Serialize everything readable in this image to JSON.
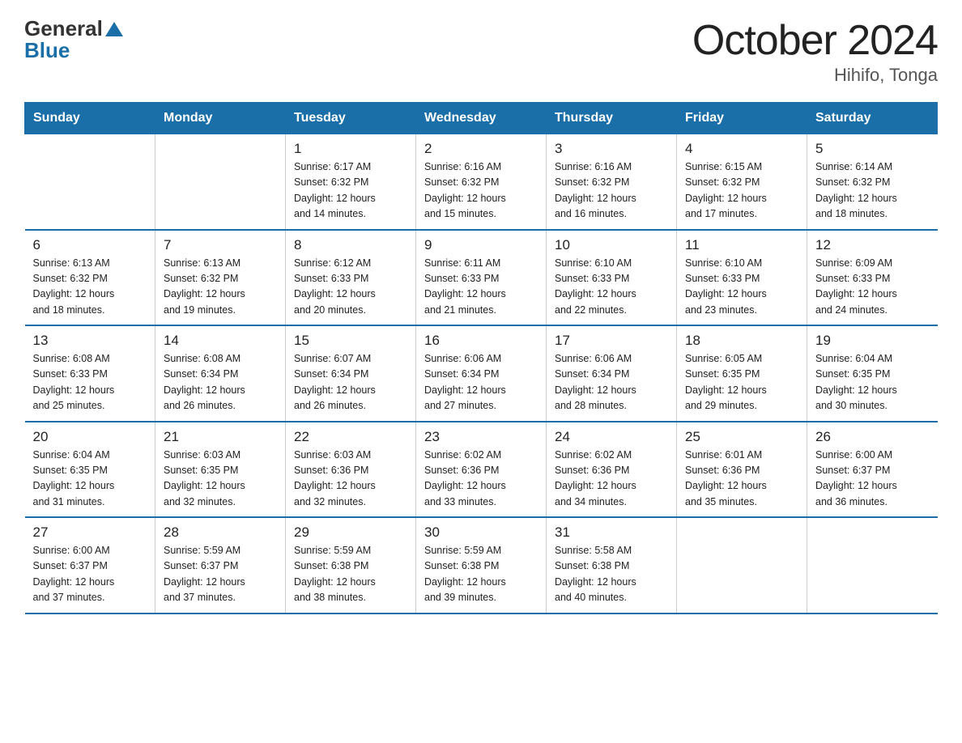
{
  "header": {
    "logo_general": "General",
    "logo_blue": "Blue",
    "title": "October 2024",
    "subtitle": "Hihifo, Tonga"
  },
  "calendar": {
    "days_of_week": [
      "Sunday",
      "Monday",
      "Tuesday",
      "Wednesday",
      "Thursday",
      "Friday",
      "Saturday"
    ],
    "weeks": [
      [
        {
          "day": "",
          "info": ""
        },
        {
          "day": "",
          "info": ""
        },
        {
          "day": "1",
          "info": "Sunrise: 6:17 AM\nSunset: 6:32 PM\nDaylight: 12 hours\nand 14 minutes."
        },
        {
          "day": "2",
          "info": "Sunrise: 6:16 AM\nSunset: 6:32 PM\nDaylight: 12 hours\nand 15 minutes."
        },
        {
          "day": "3",
          "info": "Sunrise: 6:16 AM\nSunset: 6:32 PM\nDaylight: 12 hours\nand 16 minutes."
        },
        {
          "day": "4",
          "info": "Sunrise: 6:15 AM\nSunset: 6:32 PM\nDaylight: 12 hours\nand 17 minutes."
        },
        {
          "day": "5",
          "info": "Sunrise: 6:14 AM\nSunset: 6:32 PM\nDaylight: 12 hours\nand 18 minutes."
        }
      ],
      [
        {
          "day": "6",
          "info": "Sunrise: 6:13 AM\nSunset: 6:32 PM\nDaylight: 12 hours\nand 18 minutes."
        },
        {
          "day": "7",
          "info": "Sunrise: 6:13 AM\nSunset: 6:32 PM\nDaylight: 12 hours\nand 19 minutes."
        },
        {
          "day": "8",
          "info": "Sunrise: 6:12 AM\nSunset: 6:33 PM\nDaylight: 12 hours\nand 20 minutes."
        },
        {
          "day": "9",
          "info": "Sunrise: 6:11 AM\nSunset: 6:33 PM\nDaylight: 12 hours\nand 21 minutes."
        },
        {
          "day": "10",
          "info": "Sunrise: 6:10 AM\nSunset: 6:33 PM\nDaylight: 12 hours\nand 22 minutes."
        },
        {
          "day": "11",
          "info": "Sunrise: 6:10 AM\nSunset: 6:33 PM\nDaylight: 12 hours\nand 23 minutes."
        },
        {
          "day": "12",
          "info": "Sunrise: 6:09 AM\nSunset: 6:33 PM\nDaylight: 12 hours\nand 24 minutes."
        }
      ],
      [
        {
          "day": "13",
          "info": "Sunrise: 6:08 AM\nSunset: 6:33 PM\nDaylight: 12 hours\nand 25 minutes."
        },
        {
          "day": "14",
          "info": "Sunrise: 6:08 AM\nSunset: 6:34 PM\nDaylight: 12 hours\nand 26 minutes."
        },
        {
          "day": "15",
          "info": "Sunrise: 6:07 AM\nSunset: 6:34 PM\nDaylight: 12 hours\nand 26 minutes."
        },
        {
          "day": "16",
          "info": "Sunrise: 6:06 AM\nSunset: 6:34 PM\nDaylight: 12 hours\nand 27 minutes."
        },
        {
          "day": "17",
          "info": "Sunrise: 6:06 AM\nSunset: 6:34 PM\nDaylight: 12 hours\nand 28 minutes."
        },
        {
          "day": "18",
          "info": "Sunrise: 6:05 AM\nSunset: 6:35 PM\nDaylight: 12 hours\nand 29 minutes."
        },
        {
          "day": "19",
          "info": "Sunrise: 6:04 AM\nSunset: 6:35 PM\nDaylight: 12 hours\nand 30 minutes."
        }
      ],
      [
        {
          "day": "20",
          "info": "Sunrise: 6:04 AM\nSunset: 6:35 PM\nDaylight: 12 hours\nand 31 minutes."
        },
        {
          "day": "21",
          "info": "Sunrise: 6:03 AM\nSunset: 6:35 PM\nDaylight: 12 hours\nand 32 minutes."
        },
        {
          "day": "22",
          "info": "Sunrise: 6:03 AM\nSunset: 6:36 PM\nDaylight: 12 hours\nand 32 minutes."
        },
        {
          "day": "23",
          "info": "Sunrise: 6:02 AM\nSunset: 6:36 PM\nDaylight: 12 hours\nand 33 minutes."
        },
        {
          "day": "24",
          "info": "Sunrise: 6:02 AM\nSunset: 6:36 PM\nDaylight: 12 hours\nand 34 minutes."
        },
        {
          "day": "25",
          "info": "Sunrise: 6:01 AM\nSunset: 6:36 PM\nDaylight: 12 hours\nand 35 minutes."
        },
        {
          "day": "26",
          "info": "Sunrise: 6:00 AM\nSunset: 6:37 PM\nDaylight: 12 hours\nand 36 minutes."
        }
      ],
      [
        {
          "day": "27",
          "info": "Sunrise: 6:00 AM\nSunset: 6:37 PM\nDaylight: 12 hours\nand 37 minutes."
        },
        {
          "day": "28",
          "info": "Sunrise: 5:59 AM\nSunset: 6:37 PM\nDaylight: 12 hours\nand 37 minutes."
        },
        {
          "day": "29",
          "info": "Sunrise: 5:59 AM\nSunset: 6:38 PM\nDaylight: 12 hours\nand 38 minutes."
        },
        {
          "day": "30",
          "info": "Sunrise: 5:59 AM\nSunset: 6:38 PM\nDaylight: 12 hours\nand 39 minutes."
        },
        {
          "day": "31",
          "info": "Sunrise: 5:58 AM\nSunset: 6:38 PM\nDaylight: 12 hours\nand 40 minutes."
        },
        {
          "day": "",
          "info": ""
        },
        {
          "day": "",
          "info": ""
        }
      ]
    ]
  }
}
